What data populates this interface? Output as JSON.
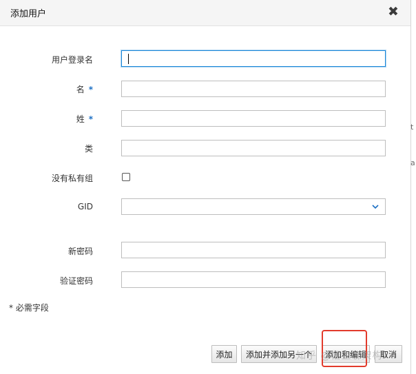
{
  "dialog": {
    "title": "添加用户",
    "close_glyph": "✖"
  },
  "fields": {
    "login_label": "用户登录名",
    "first_name_label": "名",
    "last_name_label": "姓",
    "class_label": "类",
    "no_private_group_label": "没有私有组",
    "gid_label": "GID",
    "new_password_label": "新密码",
    "verify_password_label": "验证密码",
    "required_mark": "*",
    "login_value": "",
    "first_name_value": "",
    "last_name_value": "",
    "class_value": "",
    "gid_value": "",
    "new_password_value": "",
    "verify_password_value": ""
  },
  "required_note": "* 必需字段",
  "buttons": {
    "add": "添加",
    "add_and_add_another": "添加并添加另一个",
    "add_and_edit": "添加和编辑",
    "cancel": "取消"
  },
  "watermark": "知乎 @悟空聊架构",
  "background_edge": [
    "t",
    "a"
  ],
  "colors": {
    "accent": "#1b6fc4",
    "focus_border": "#1b87d8",
    "highlight": "#e23a2b"
  },
  "icons": {
    "close": "close-icon",
    "dropdown": "chevron-down-icon"
  }
}
